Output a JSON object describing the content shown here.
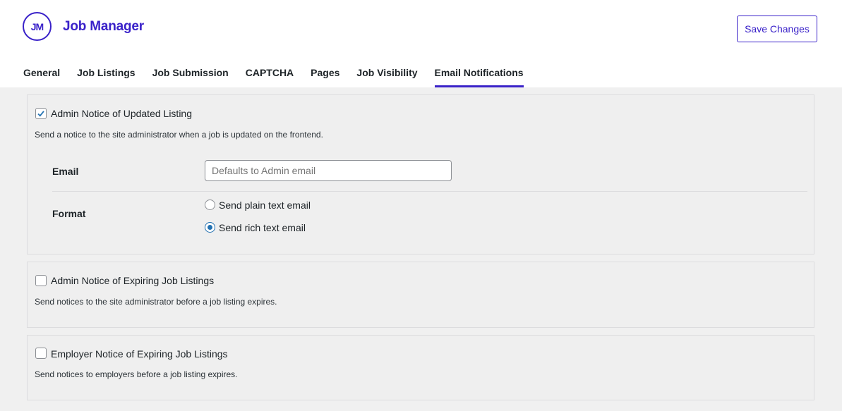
{
  "header": {
    "logo_text": "JM",
    "brand": "Job Manager",
    "save_label": "Save Changes"
  },
  "tabs": [
    {
      "label": "General",
      "active": false
    },
    {
      "label": "Job Listings",
      "active": false
    },
    {
      "label": "Job Submission",
      "active": false
    },
    {
      "label": "CAPTCHA",
      "active": false
    },
    {
      "label": "Pages",
      "active": false
    },
    {
      "label": "Job Visibility",
      "active": false
    },
    {
      "label": "Email Notifications",
      "active": true
    }
  ],
  "sections": [
    {
      "label": "Admin Notice of Updated Listing",
      "checked": true,
      "description": "Send a notice to the site administrator when a job is updated on the frontend.",
      "email_label": "Email",
      "email_placeholder": "Defaults to Admin email",
      "email_value": "",
      "format_label": "Format",
      "format_options": [
        {
          "label": "Send plain text email",
          "selected": false
        },
        {
          "label": "Send rich text email",
          "selected": true
        }
      ]
    },
    {
      "label": "Admin Notice of Expiring Job Listings",
      "checked": false,
      "description": "Send notices to the site administrator before a job listing expires."
    },
    {
      "label": "Employer Notice of Expiring Job Listings",
      "checked": false,
      "description": "Send notices to employers before a job listing expires."
    }
  ],
  "colors": {
    "brand": "#3a22c9",
    "radio_accent": "#2271b1",
    "background": "#f0f0f0"
  }
}
